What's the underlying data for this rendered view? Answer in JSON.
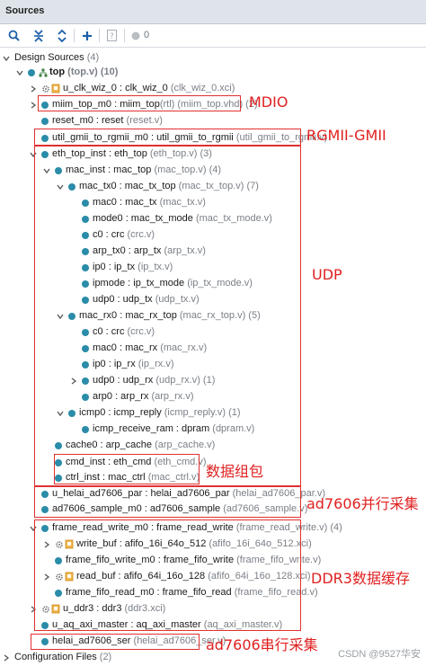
{
  "panel": {
    "title": "Sources"
  },
  "toolbar": {
    "count": "0"
  },
  "tree": [
    {
      "id": "design_sources",
      "exp": "v",
      "icon": "none",
      "name": "Design Sources",
      "meta": " (4)"
    },
    {
      "id": "top",
      "exp": "v",
      "icon": "dot-hier",
      "name": "top",
      "sep": " ",
      "meta": "(top.v) (10)",
      "bold": true
    },
    {
      "id": "u_clk_wiz_0",
      "exp": ">",
      "icon": "gear-file",
      "name": "u_clk_wiz_0 : clk_wiz_0",
      "sep": " ",
      "meta": "(clk_wiz_0.xci)"
    },
    {
      "id": "miim_top_m0",
      "exp": ">",
      "icon": "dot",
      "name": "miim_top_m0 : miim_top",
      "sep": "",
      "meta": "(rtl) (miim_top.vhd) (2)"
    },
    {
      "id": "reset_m0",
      "exp": "",
      "icon": "dot",
      "name": "reset_m0 : reset",
      "sep": " ",
      "meta": "(reset.v)"
    },
    {
      "id": "util_gmii",
      "exp": "",
      "icon": "dot",
      "name": "util_gmii_to_rgmii_m0 : util_gmii_to_rgmii",
      "sep": " ",
      "meta": "(util_gmii_to_rgmii.v)"
    },
    {
      "id": "eth_top_inst",
      "exp": "v",
      "icon": "dot",
      "name": "eth_top_inst : eth_top",
      "sep": " ",
      "meta": "(eth_top.v) (3)"
    },
    {
      "id": "mac_inst",
      "exp": "v",
      "icon": "dot",
      "name": "mac_inst : mac_top",
      "sep": " ",
      "meta": "(mac_top.v) (4)"
    },
    {
      "id": "mac_tx0",
      "exp": "v",
      "icon": "dot",
      "name": "mac_tx0 : mac_tx_top",
      "sep": " ",
      "meta": "(mac_tx_top.v) (7)"
    },
    {
      "id": "mac0_tx",
      "exp": "",
      "icon": "dot",
      "name": "mac0 : mac_tx",
      "sep": " ",
      "meta": "(mac_tx.v)"
    },
    {
      "id": "mode0",
      "exp": "",
      "icon": "dot",
      "name": "mode0 : mac_tx_mode",
      "sep": " ",
      "meta": "(mac_tx_mode.v)"
    },
    {
      "id": "c0_tx",
      "exp": "",
      "icon": "dot",
      "name": "c0 : crc",
      "sep": " ",
      "meta": "(crc.v)"
    },
    {
      "id": "arp_tx0",
      "exp": "",
      "icon": "dot",
      "name": "arp_tx0 : arp_tx",
      "sep": " ",
      "meta": "(arp_tx.v)"
    },
    {
      "id": "ip0_tx",
      "exp": "",
      "icon": "dot",
      "name": "ip0 : ip_tx",
      "sep": " ",
      "meta": "(ip_tx.v)"
    },
    {
      "id": "ipmode",
      "exp": "",
      "icon": "dot",
      "name": "ipmode : ip_tx_mode",
      "sep": " ",
      "meta": "(ip_tx_mode.v)"
    },
    {
      "id": "udp0_tx",
      "exp": "",
      "icon": "dot",
      "name": "udp0 : udp_tx",
      "sep": " ",
      "meta": "(udp_tx.v)"
    },
    {
      "id": "mac_rx0",
      "exp": "v",
      "icon": "dot",
      "name": "mac_rx0 : mac_rx_top",
      "sep": " ",
      "meta": "(mac_rx_top.v) (5)"
    },
    {
      "id": "c0_rx",
      "exp": "",
      "icon": "dot",
      "name": "c0 : crc",
      "sep": " ",
      "meta": "(crc.v)"
    },
    {
      "id": "mac0_rx",
      "exp": "",
      "icon": "dot",
      "name": "mac0 : mac_rx",
      "sep": " ",
      "meta": "(mac_rx.v)"
    },
    {
      "id": "ip0_rx",
      "exp": "",
      "icon": "dot",
      "name": "ip0 : ip_rx",
      "sep": " ",
      "meta": "(ip_rx.v)"
    },
    {
      "id": "udp0_rx",
      "exp": ">",
      "icon": "dot",
      "name": "udp0 : udp_rx",
      "sep": " ",
      "meta": "(udp_rx.v) (1)"
    },
    {
      "id": "arp0",
      "exp": "",
      "icon": "dot",
      "name": "arp0 : arp_rx",
      "sep": " ",
      "meta": "(arp_rx.v)"
    },
    {
      "id": "icmp0",
      "exp": "v",
      "icon": "dot",
      "name": "icmp0 : icmp_reply",
      "sep": " ",
      "meta": "(icmp_reply.v) (1)"
    },
    {
      "id": "icmp_receive_ram",
      "exp": "",
      "icon": "dot",
      "name": "icmp_receive_ram : dpram",
      "sep": " ",
      "meta": "(dpram.v)"
    },
    {
      "id": "cache0",
      "exp": "",
      "icon": "dot",
      "name": "cache0 : arp_cache",
      "sep": " ",
      "meta": "(arp_cache.v)"
    },
    {
      "id": "cmd_inst",
      "exp": "",
      "icon": "dot",
      "name": "cmd_inst : eth_cmd",
      "sep": " ",
      "meta": "(eth_cmd.v)"
    },
    {
      "id": "ctrl_inst",
      "exp": "",
      "icon": "dot",
      "name": "ctrl_inst : mac_ctrl",
      "sep": " ",
      "meta": "(mac_ctrl.v)"
    },
    {
      "id": "u_helai_par",
      "exp": "",
      "icon": "dot",
      "name": "u_helai_ad7606_par : helai_ad7606_par",
      "sep": " ",
      "meta": "(helai_ad7606_par.v)"
    },
    {
      "id": "ad7606_sample",
      "exp": "",
      "icon": "dot",
      "name": "ad7606_sample_m0 : ad7606_sample",
      "sep": " ",
      "meta": "(ad7606_sample.v)"
    },
    {
      "id": "frame_read_write",
      "exp": "v",
      "icon": "dot",
      "name": "frame_read_write_m0 : frame_read_write",
      "sep": " ",
      "meta": "(frame_read_write.v) (4)"
    },
    {
      "id": "write_buf",
      "exp": ">",
      "icon": "gear-file",
      "name": "write_buf : afifo_16i_64o_512",
      "sep": " ",
      "meta": "(afifo_16i_64o_512.xci)"
    },
    {
      "id": "frame_fifo_write",
      "exp": "",
      "icon": "dot",
      "name": "frame_fifo_write_m0 : frame_fifo_write",
      "sep": " ",
      "meta": "(frame_fifo_write.v)"
    },
    {
      "id": "read_buf",
      "exp": ">",
      "icon": "gear-file",
      "name": "read_buf : afifo_64i_16o_128",
      "sep": " ",
      "meta": "(afifo_64i_16o_128.xci)"
    },
    {
      "id": "frame_fifo_read",
      "exp": "",
      "icon": "dot",
      "name": "frame_fifo_read_m0 : frame_fifo_read",
      "sep": " ",
      "meta": "(frame_fifo_read.v)"
    },
    {
      "id": "u_ddr3",
      "exp": ">",
      "icon": "gear-file",
      "name": "u_ddr3 : ddr3",
      "sep": " ",
      "meta": "(ddr3.xci)"
    },
    {
      "id": "u_aq_axi_master",
      "exp": "",
      "icon": "dot",
      "name": "u_aq_axi_master : aq_axi_master",
      "sep": " ",
      "meta": "(aq_axi_master.v)"
    },
    {
      "id": "helai_ser",
      "exp": "",
      "icon": "dot",
      "name": "helai_ad7606_ser",
      "sep": " ",
      "meta": "(helai_ad7606_ser.v)"
    },
    {
      "id": "config_files",
      "exp": ">",
      "icon": "none",
      "name": "Configuration Files",
      "meta": " (2)"
    }
  ],
  "annotations": {
    "mdio": "MDIO",
    "rgmii": "RGMII-GMII",
    "udp": "UDP",
    "packet": "数据组包",
    "par": "ad7606并行采集",
    "ddr3": "DDR3数据缓存",
    "ser": "ad7606串行采集"
  },
  "watermark": "CSDN @9527华安",
  "colors": {
    "accent": "#2a8ca8",
    "annotation": "#e02020",
    "meta_text": "#7a7f86"
  }
}
